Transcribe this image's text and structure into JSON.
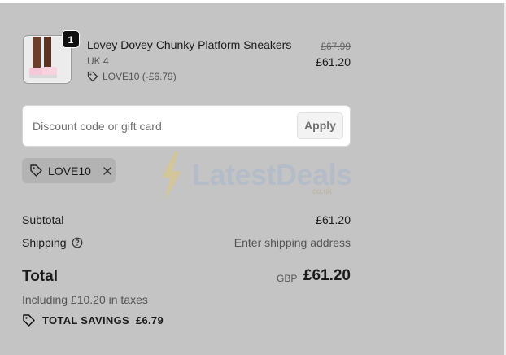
{
  "line_item": {
    "quantity": "1",
    "name": "Lovey Dovey Chunky Platform Sneakers",
    "variant": "UK 4",
    "discount_tag": "LOVE10 (-£6.79)",
    "original_price": "£67.99",
    "price": "£61.20"
  },
  "discount": {
    "placeholder": "Discount code or gift card",
    "apply_label": "Apply",
    "applied_code": "LOVE10"
  },
  "watermark": {
    "brand": "LatestDeals",
    "sub": "co.uk"
  },
  "summary": {
    "subtotal_label": "Subtotal",
    "subtotal_value": "£61.20",
    "shipping_label": "Shipping",
    "shipping_value": "Enter shipping address",
    "total_label": "Total",
    "currency": "GBP",
    "total_value": "£61.20",
    "taxes_note": "Including £10.20 in taxes",
    "savings_label": "TOTAL SAVINGS",
    "savings_value": "£6.79"
  },
  "colors": {
    "panel_bg": "#c4c4c4",
    "chip_bg": "#b3b3b3"
  }
}
